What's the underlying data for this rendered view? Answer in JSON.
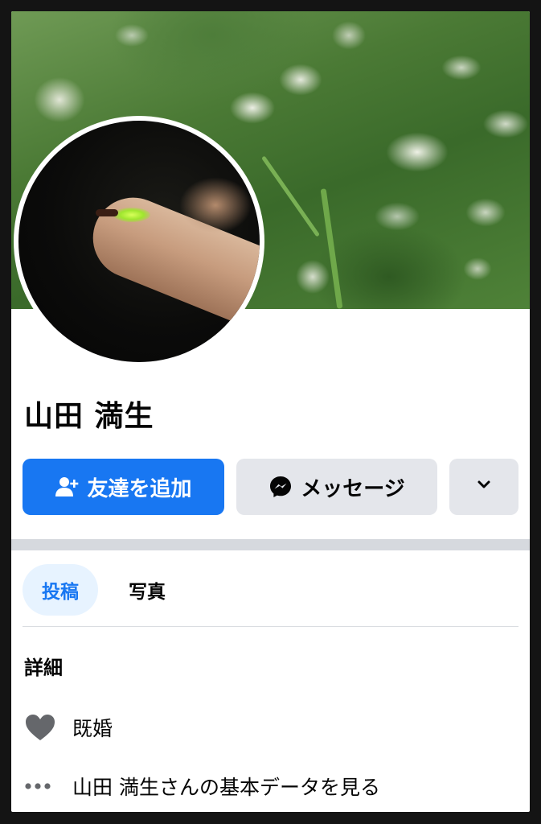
{
  "profile": {
    "name": "山田 満生"
  },
  "actions": {
    "add_friend": "友達を追加",
    "message": "メッセージ"
  },
  "tabs": [
    {
      "label": "投稿",
      "active": true
    },
    {
      "label": "写真",
      "active": false
    }
  ],
  "details": {
    "heading": "詳細",
    "items": [
      {
        "icon": "heart-icon",
        "text": "既婚"
      },
      {
        "icon": "more-dots-icon",
        "text": "山田 満生さんの基本データを見る"
      }
    ]
  },
  "colors": {
    "primary": "#1877f2",
    "secondary_button": "#e4e6eb",
    "active_tab_bg": "#e7f3ff",
    "icon_gray": "#65676b"
  }
}
